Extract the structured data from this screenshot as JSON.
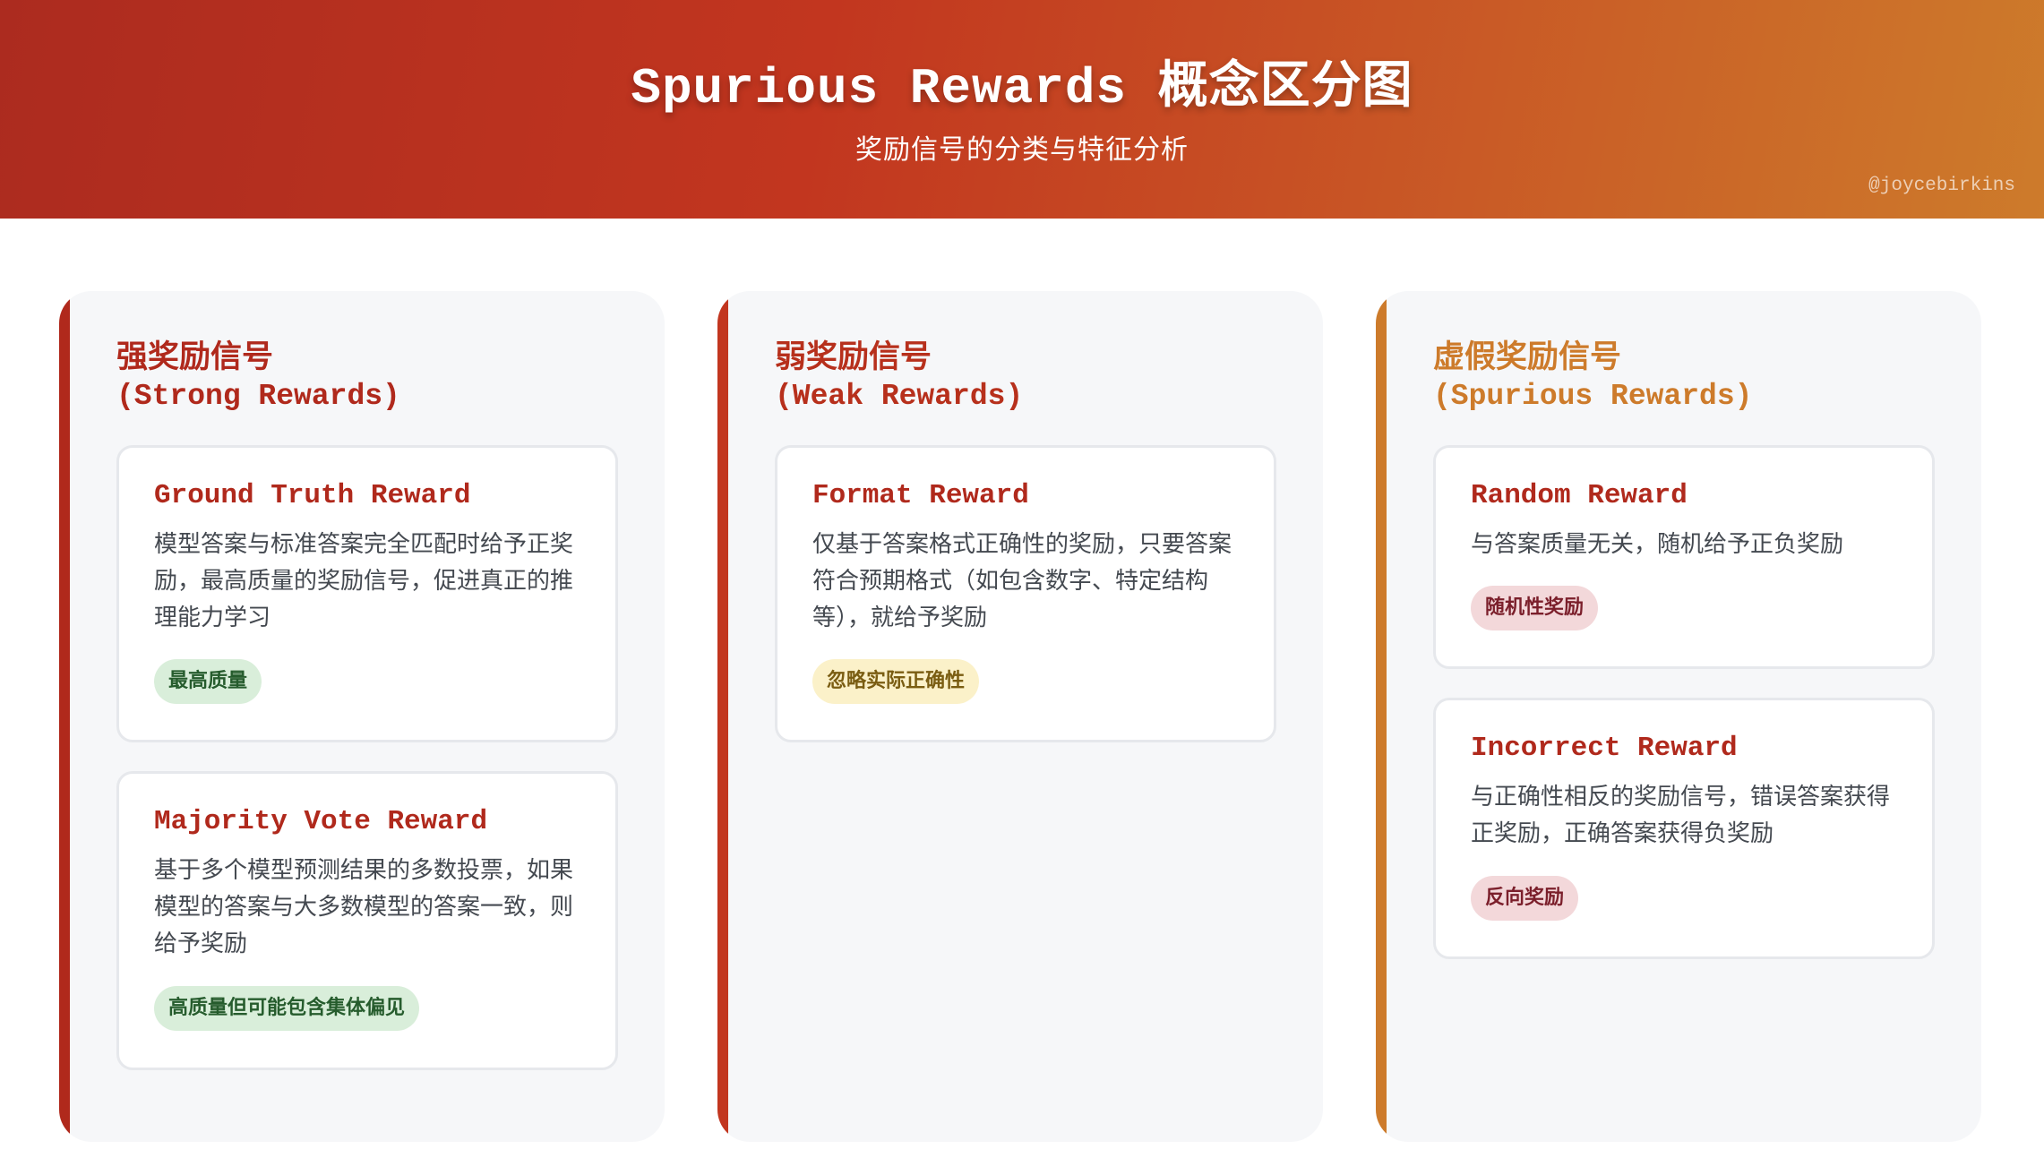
{
  "header": {
    "title": "Spurious Rewards 概念区分图",
    "subtitle": "奖励信号的分类与特征分析",
    "watermark": "@joycebirkins"
  },
  "colors": {
    "header_gradient_start": "#ac2b1f",
    "header_gradient_end": "#cd7b2b",
    "strong_accent": "#b0291c",
    "weak_accent": "#c2361f",
    "spurious_accent": "#cd7b2b",
    "column_background": "#f6f7f9"
  },
  "columns": [
    {
      "title_cn": "强奖励信号",
      "title_en": "(Strong Rewards)",
      "cards": [
        {
          "title": "Ground Truth Reward",
          "description": "模型答案与标准答案完全匹配时给予正奖励，最高质量的奖励信号，促进真正的推理能力学习",
          "tag": "最高质量"
        },
        {
          "title": "Majority Vote Reward",
          "description": "基于多个模型预测结果的多数投票，如果模型的答案与大多数模型的答案一致，则给予奖励",
          "tag": "高质量但可能包含集体偏见"
        }
      ]
    },
    {
      "title_cn": "弱奖励信号",
      "title_en": "(Weak Rewards)",
      "cards": [
        {
          "title": "Format Reward",
          "description": "仅基于答案格式正确性的奖励，只要答案符合预期格式（如包含数字、特定结构等），就给予奖励",
          "tag": "忽略实际正确性"
        }
      ]
    },
    {
      "title_cn": "虚假奖励信号",
      "title_en": "(Spurious Rewards)",
      "cards": [
        {
          "title": "Random Reward",
          "description": "与答案质量无关，随机给予正负奖励",
          "tag": "随机性奖励"
        },
        {
          "title": "Incorrect Reward",
          "description": "与正确性相反的奖励信号，错误答案获得正奖励，正确答案获得负奖励",
          "tag": "反向奖励"
        }
      ]
    }
  ]
}
